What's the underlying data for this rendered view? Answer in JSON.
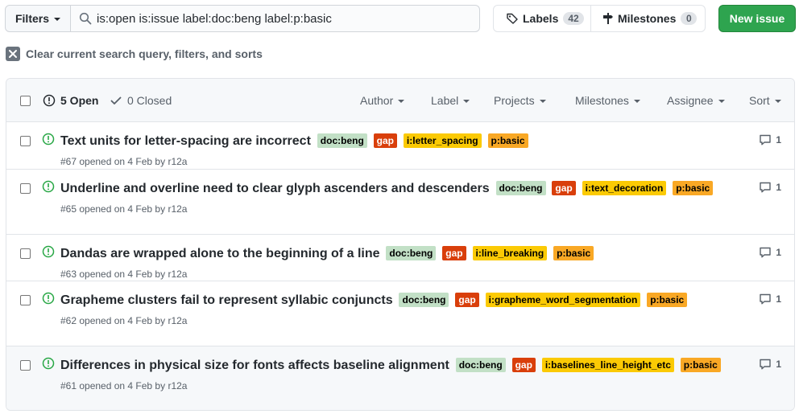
{
  "toolbar": {
    "filters_label": "Filters",
    "search_value": "is:open is:issue label:doc:beng label:p:basic",
    "labels_label": "Labels",
    "labels_count": "42",
    "milestones_label": "Milestones",
    "milestones_count": "0",
    "new_issue_label": "New issue"
  },
  "clear_query_label": "Clear current search query, filters, and sorts",
  "header": {
    "open_label": "5 Open",
    "closed_label": "0 Closed",
    "filters": [
      "Author",
      "Label",
      "Projects",
      "Milestones",
      "Assignee",
      "Sort"
    ]
  },
  "issues": [
    {
      "title": "Text units for letter-spacing are incorrect",
      "labels": [
        "doc:beng",
        "gap",
        "i:letter_spacing",
        "p:basic"
      ],
      "meta": "#67 opened on 4 Feb by r12a",
      "comments": "1"
    },
    {
      "title": "Underline and overline need to clear glyph ascenders and descenders",
      "labels": [
        "doc:beng",
        "gap",
        "i:text_decoration",
        "p:basic"
      ],
      "meta": "#65 opened on 4 Feb by r12a",
      "comments": "1"
    },
    {
      "title": "Dandas are wrapped alone to the beginning of a line",
      "labels": [
        "doc:beng",
        "gap",
        "i:line_breaking",
        "p:basic"
      ],
      "meta": "#63 opened on 4 Feb by r12a",
      "comments": "1"
    },
    {
      "title": "Grapheme clusters fail to represent syllabic conjuncts",
      "labels": [
        "doc:beng",
        "gap",
        "i:grapheme_word_segmentation",
        "p:basic"
      ],
      "meta": "#62 opened on 4 Feb by r12a",
      "comments": "1"
    },
    {
      "title": "Differences in physical size for fonts affects baseline alignment",
      "labels": [
        "doc:beng",
        "gap",
        "i:baselines_line_height_etc",
        "p:basic"
      ],
      "meta": "#61 opened on 4 Feb by r12a",
      "comments": "1"
    }
  ],
  "colors": {
    "label_doc": "#c2e0c6",
    "label_gap": "#d93f0b",
    "label_i": "#fbca04",
    "label_p": "#f9a825",
    "open_icon": "#28a745",
    "new_issue_bg": "#2ea44f"
  },
  "icons": [
    "search-icon",
    "tag-icon",
    "milestone-icon",
    "x-icon",
    "issue-opened-icon",
    "check-icon",
    "comment-icon"
  ]
}
